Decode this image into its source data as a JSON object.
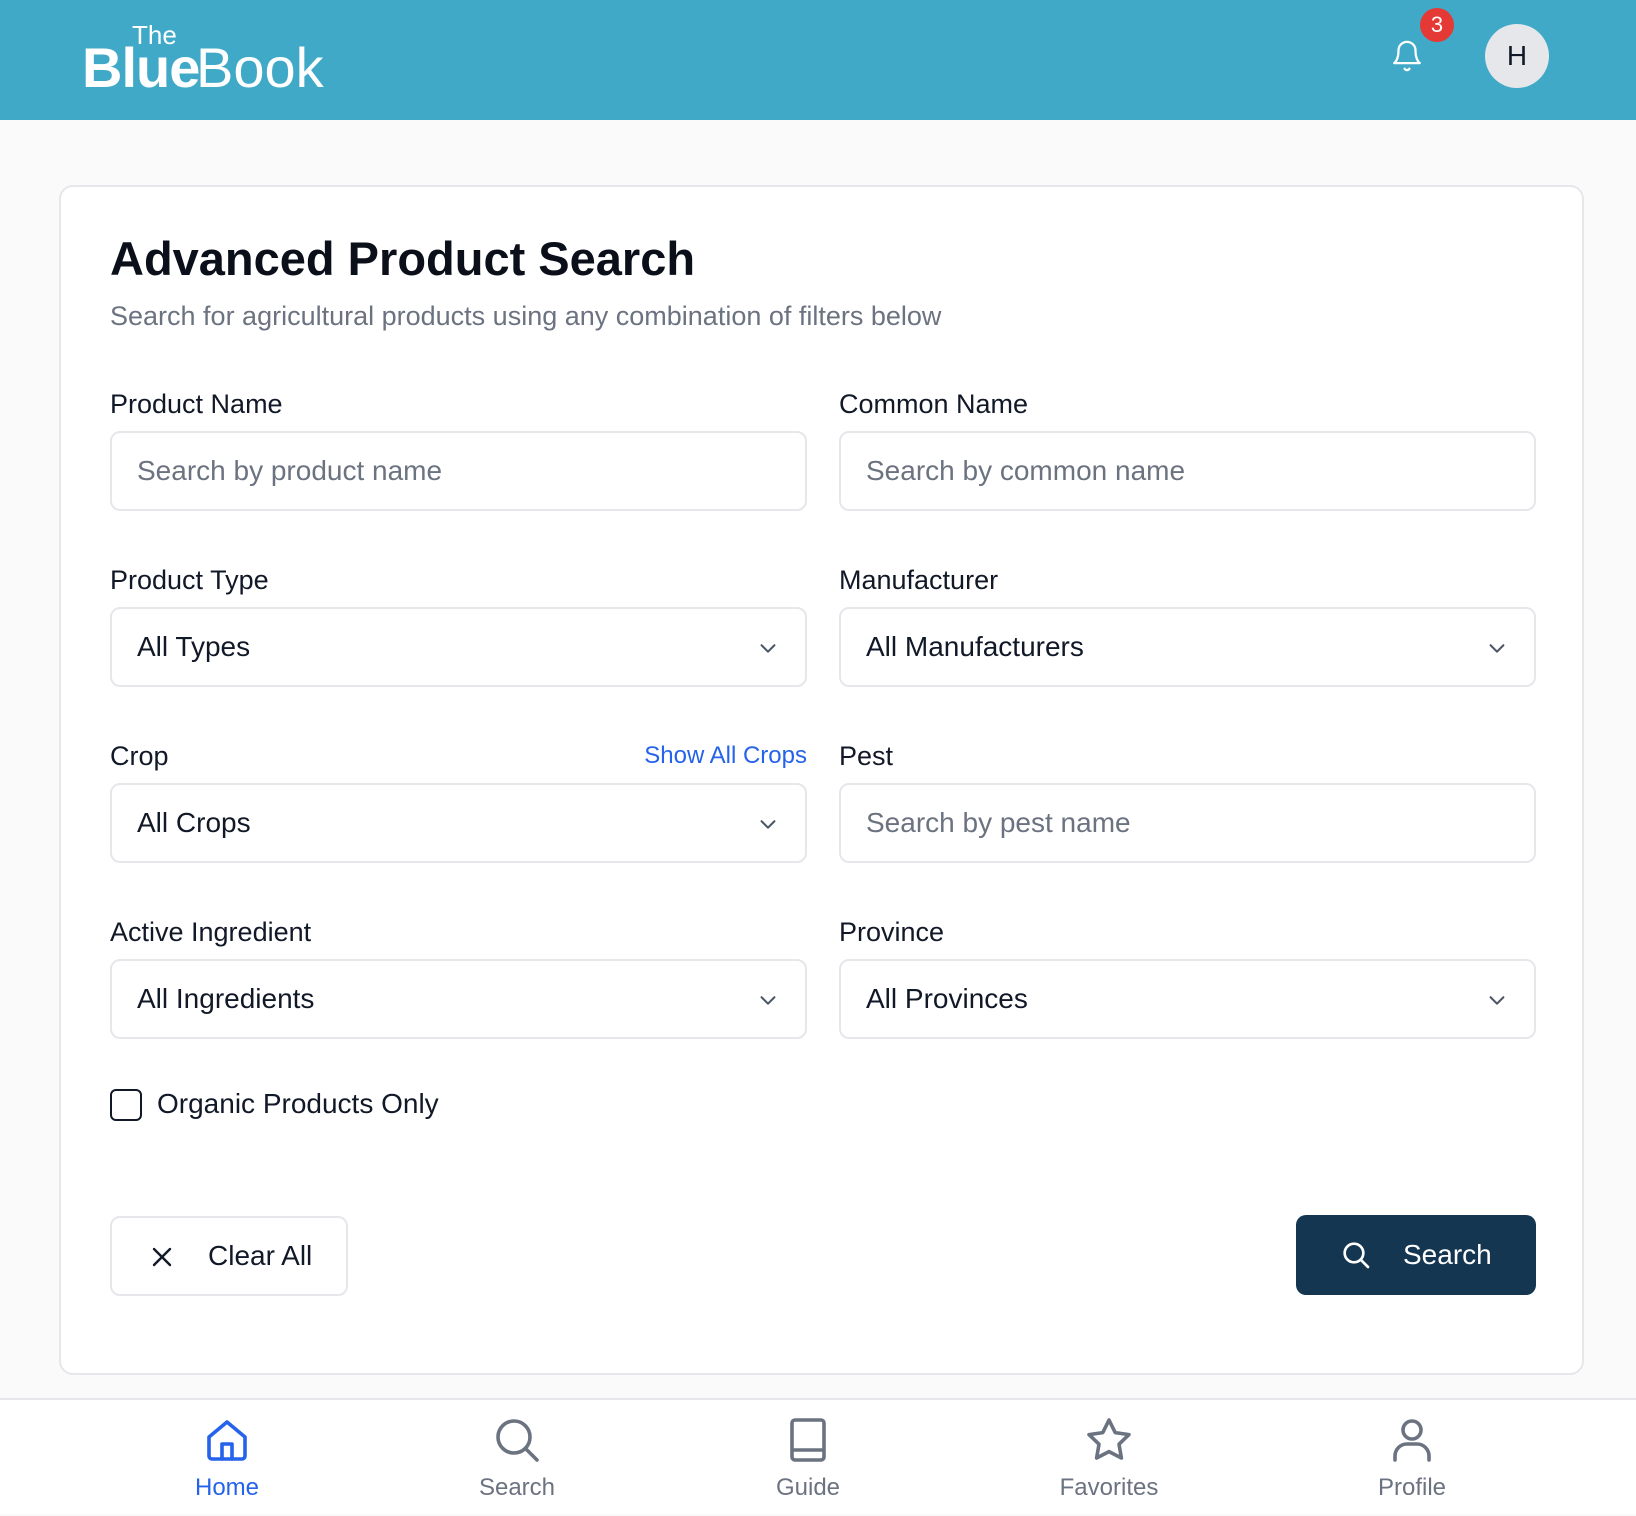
{
  "header": {
    "logo_the": "The",
    "logo_blue": "Blue",
    "logo_book": "Book",
    "notification_count": "3",
    "avatar_initial": "H"
  },
  "page": {
    "title": "Advanced Product Search",
    "subtitle": "Search for agricultural products using any combination of filters below"
  },
  "form": {
    "product_name": {
      "label": "Product Name",
      "placeholder": "Search by product name",
      "value": ""
    },
    "common_name": {
      "label": "Common Name",
      "placeholder": "Search by common name",
      "value": ""
    },
    "product_type": {
      "label": "Product Type",
      "selected": "All Types"
    },
    "manufacturer": {
      "label": "Manufacturer",
      "selected": "All Manufacturers"
    },
    "crop": {
      "label": "Crop",
      "selected": "All Crops",
      "link": "Show All Crops"
    },
    "pest": {
      "label": "Pest",
      "placeholder": "Search by pest name",
      "value": ""
    },
    "active_ingredient": {
      "label": "Active Ingredient",
      "selected": "All Ingredients"
    },
    "province": {
      "label": "Province",
      "selected": "All Provinces"
    },
    "organic": {
      "label": "Organic Products Only",
      "checked": false
    },
    "clear_label": "Clear All",
    "search_label": "Search"
  },
  "bottom_nav": {
    "items": [
      {
        "label": "Home",
        "icon": "home-icon",
        "active": true
      },
      {
        "label": "Search",
        "icon": "search-icon",
        "active": false
      },
      {
        "label": "Guide",
        "icon": "book-icon",
        "active": false
      },
      {
        "label": "Favorites",
        "icon": "star-icon",
        "active": false
      },
      {
        "label": "Profile",
        "icon": "user-icon",
        "active": false
      }
    ]
  },
  "colors": {
    "header_bg": "#3fa9c7",
    "primary_button": "#143651",
    "link": "#2563eb",
    "badge": "#e53935"
  }
}
